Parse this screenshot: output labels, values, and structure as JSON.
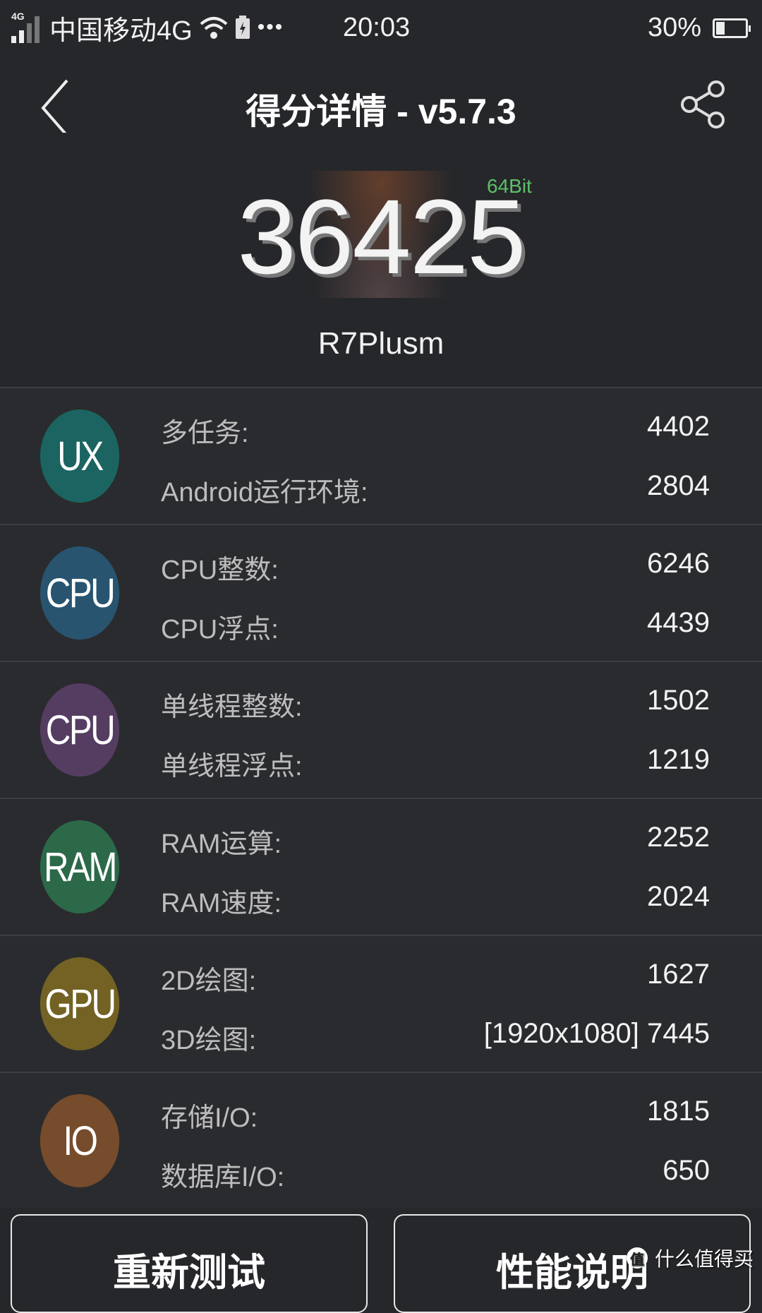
{
  "status_bar": {
    "network_tag": "4G",
    "carrier": "中国移动4G",
    "overflow": "•••",
    "time": "20:03",
    "battery_percent_label": "30%",
    "battery_level": 0.3
  },
  "header": {
    "title": "得分详情 - v5.7.3",
    "back_icon": "chevron-left-icon",
    "share_icon": "share-icon"
  },
  "score": {
    "total": "36425",
    "arch_badge": "64Bit",
    "device": "R7Plusm"
  },
  "categories": [
    {
      "badge": "UX",
      "color": "#1b6461",
      "items": [
        {
          "label": "多任务:",
          "value": "4402"
        },
        {
          "label": "Android运行环境:",
          "value": "2804"
        }
      ]
    },
    {
      "badge": "CPU",
      "color": "#285470",
      "items": [
        {
          "label": "CPU整数:",
          "value": "6246"
        },
        {
          "label": "CPU浮点:",
          "value": "4439"
        }
      ]
    },
    {
      "badge": "CPU",
      "color": "#553d62",
      "items": [
        {
          "label": "单线程整数:",
          "value": "1502"
        },
        {
          "label": "单线程浮点:",
          "value": "1219"
        }
      ]
    },
    {
      "badge": "RAM",
      "color": "#2b6949",
      "items": [
        {
          "label": "RAM运算:",
          "value": "2252"
        },
        {
          "label": "RAM速度:",
          "value": "2024"
        }
      ]
    },
    {
      "badge": "GPU",
      "color": "#736224",
      "items": [
        {
          "label": "2D绘图:",
          "value": "1627"
        },
        {
          "label": "3D绘图:",
          "value": "[1920x1080] 7445"
        }
      ]
    },
    {
      "badge": "IO",
      "color": "#764c2c",
      "items": [
        {
          "label": "存储I/O:",
          "value": "1815"
        },
        {
          "label": "数据库I/O:",
          "value": "650"
        }
      ]
    }
  ],
  "buttons": {
    "retest": "重新测试",
    "explain": "性能说明"
  },
  "watermark": {
    "logo": "值",
    "text": "什么值得买"
  }
}
